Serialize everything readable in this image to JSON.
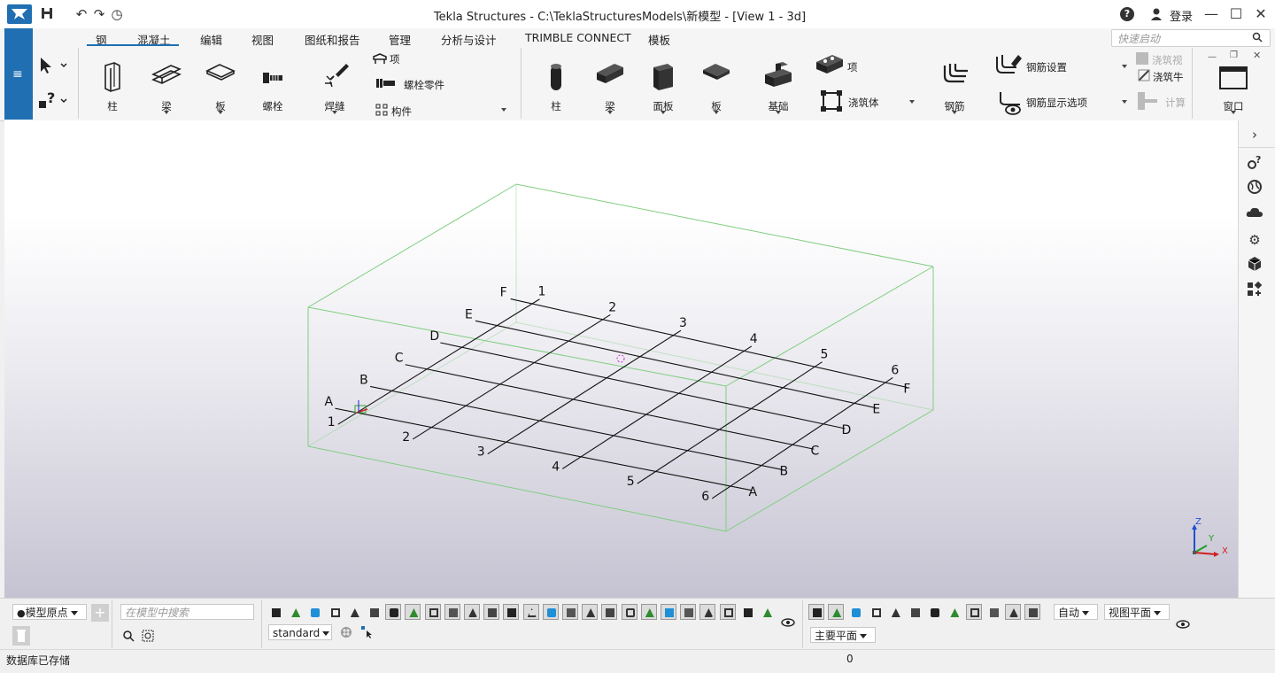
{
  "window": {
    "title": "Tekla Structures - C:\\TeklaStructuresModels\\新模型  - [View 1 - 3d]",
    "login": "登录"
  },
  "ribbon": {
    "tabs": [
      "钢",
      "混凝土",
      "编辑",
      "视图",
      "图纸和报告",
      "管理",
      "分析与设计",
      "TRIMBLE CONNECT",
      "模板"
    ],
    "quick_launch_placeholder": "快速启动",
    "steel": {
      "column": "柱",
      "beam": "梁",
      "plate": "板",
      "bolt": "螺栓",
      "weld": "焊缝",
      "item": "项",
      "bolt_parts": "螺栓零件",
      "component": "构件"
    },
    "concrete": {
      "column": "柱",
      "beam": "梁",
      "panel": "面板",
      "slab": "板",
      "footing": "基础",
      "item": "项",
      "pour": "浇筑体",
      "rebar": "钢筋",
      "rebar_settings": "钢筋设置",
      "rebar_display": "钢筋显示选项",
      "pour_view": "浇筑视",
      "pour_item": "浇筑牛",
      "calc": "计算"
    },
    "window_label": "窗口"
  },
  "grid": {
    "numbers": [
      "1",
      "2",
      "3",
      "4",
      "5",
      "6"
    ],
    "letters": [
      "A",
      "B",
      "C",
      "D",
      "E",
      "F"
    ]
  },
  "axes": {
    "x": "X",
    "y": "Y",
    "z": "Z"
  },
  "bottom": {
    "origin_select": "模型原点",
    "search_placeholder": "在模型中搜索",
    "filter_select": "standard",
    "snap_mode": "自动",
    "plane_view": "视图平面",
    "plane_main": "主要平面"
  },
  "status": {
    "message": "数据库已存储",
    "count": "0"
  }
}
